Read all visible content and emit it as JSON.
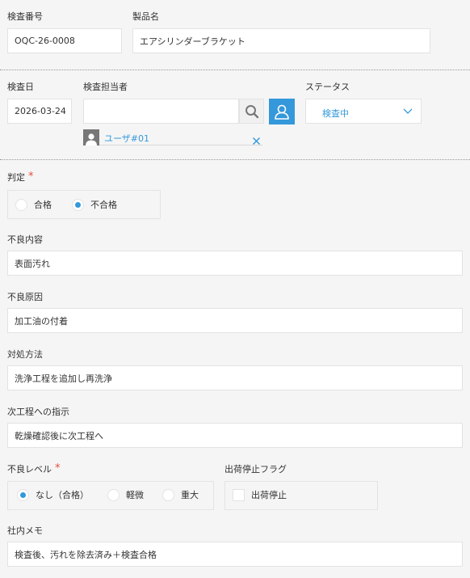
{
  "fields": {
    "inspection_no": {
      "label": "検査番号",
      "value": "OQC-26-0008"
    },
    "product_name": {
      "label": "製品名",
      "value": "エアシリンダーブラケット"
    },
    "inspection_date": {
      "label": "検査日",
      "value": "2026-03-24"
    },
    "inspector": {
      "label": "検査担当者",
      "search_value": "",
      "selected_user": "ユーザ#01"
    },
    "status": {
      "label": "ステータス",
      "value": "検査中"
    },
    "judgment": {
      "label": "判定",
      "required_mark": "*",
      "options": [
        "合格",
        "不合格"
      ],
      "selected": "不合格"
    },
    "defect_detail": {
      "label": "不良内容",
      "value": "表面汚れ"
    },
    "defect_cause": {
      "label": "不良原因",
      "value": "加工油の付着"
    },
    "countermeasure": {
      "label": "対処方法",
      "value": "洗浄工程を追加し再洗浄"
    },
    "next_instruction": {
      "label": "次工程への指示",
      "value": "乾燥確認後に次工程へ"
    },
    "defect_level": {
      "label": "不良レベル",
      "required_mark": "*",
      "options": [
        "なし（合格）",
        "軽微",
        "重大"
      ],
      "selected": "なし（合格）"
    },
    "shipment_hold": {
      "label": "出荷停止フラグ",
      "option": "出荷停止",
      "checked": false
    },
    "internal_memo": {
      "label": "社内メモ",
      "value": "検査後、汚れを除去済み＋検査合格"
    }
  },
  "colors": {
    "accent": "#3498db",
    "required": "#e74c3c",
    "background": "#f5f5f5"
  }
}
